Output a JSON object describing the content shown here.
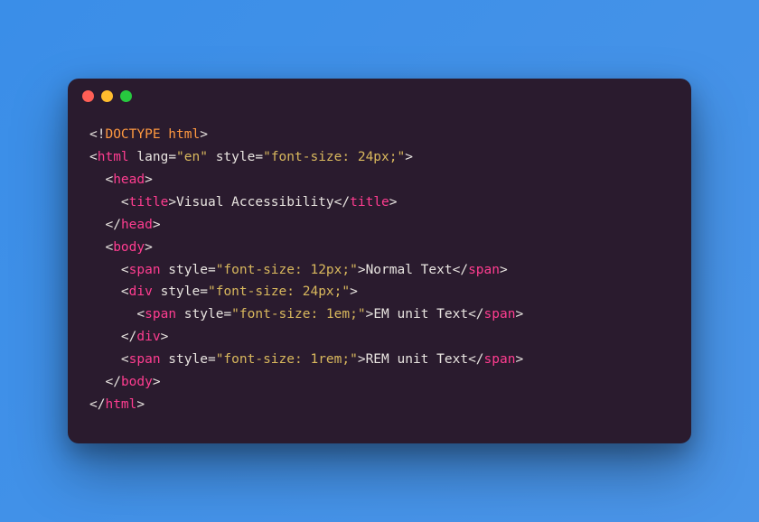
{
  "window": {
    "controls": [
      "close",
      "minimize",
      "maximize"
    ]
  },
  "code": {
    "line1": {
      "bang": "<!",
      "doctype": "DOCTYPE html",
      "close": ">"
    },
    "line2": {
      "open": "<",
      "tag": "html",
      "attr1": " lang",
      "eq1": "=",
      "val1": "\"en\"",
      "attr2": " style",
      "eq2": "=",
      "val2": "\"font-size: 24px;\"",
      "close": ">"
    },
    "line3": {
      "indent": "  ",
      "open": "<",
      "tag": "head",
      "close": ">"
    },
    "line4": {
      "indent": "    ",
      "open": "<",
      "tag": "title",
      "close1": ">",
      "text": "Visual Accessibility",
      "open2": "</",
      "tag2": "title",
      "close2": ">"
    },
    "line5": {
      "indent": "  ",
      "open": "</",
      "tag": "head",
      "close": ">"
    },
    "line6": {
      "indent": "  ",
      "open": "<",
      "tag": "body",
      "close": ">"
    },
    "line7": {
      "indent": "    ",
      "open": "<",
      "tag": "span",
      "attr": " style",
      "eq": "=",
      "val": "\"font-size: 12px;\"",
      "close1": ">",
      "text": "Normal Text",
      "open2": "</",
      "tag2": "span",
      "close2": ">"
    },
    "line8": {
      "indent": "    ",
      "open": "<",
      "tag": "div",
      "attr": " style",
      "eq": "=",
      "val": "\"font-size: 24px;\"",
      "close": ">"
    },
    "line9": {
      "indent": "      ",
      "open": "<",
      "tag": "span",
      "attr": " style",
      "eq": "=",
      "val": "\"font-size: 1em;\"",
      "close1": ">",
      "text": "EM unit Text",
      "open2": "</",
      "tag2": "span",
      "close2": ">"
    },
    "line10": {
      "indent": "    ",
      "open": "</",
      "tag": "div",
      "close": ">"
    },
    "line11": {
      "indent": "    ",
      "open": "<",
      "tag": "span",
      "attr": " style",
      "eq": "=",
      "val": "\"font-size: 1rem;\"",
      "close1": ">",
      "text": "REM unit Text",
      "open2": "</",
      "tag2": "span",
      "close2": ">"
    },
    "line12": {
      "indent": "  ",
      "open": "</",
      "tag": "body",
      "close": ">"
    },
    "line13": {
      "open": "</",
      "tag": "html",
      "close": ">"
    }
  }
}
